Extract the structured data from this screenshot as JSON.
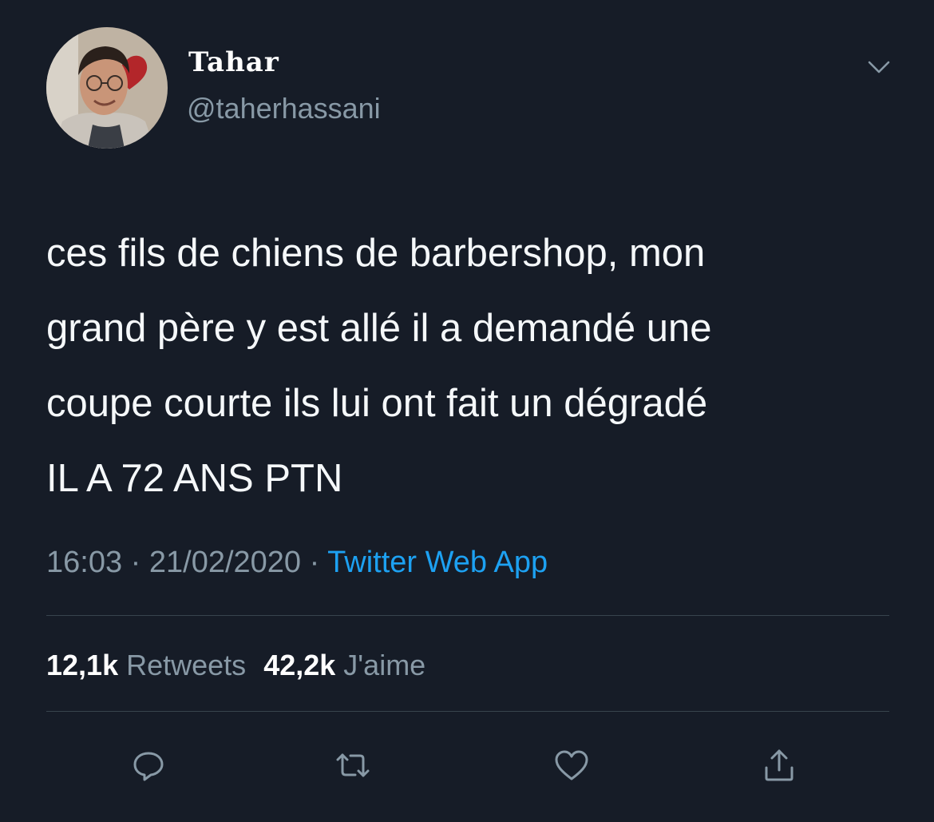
{
  "colors": {
    "background": "#161c27",
    "text_primary": "#f5f8fa",
    "text_secondary": "#8899a6",
    "link": "#1da1f2",
    "divider": "#38444d"
  },
  "author": {
    "display_name": "Tahar",
    "handle": "@taherhassani",
    "avatar": "avatar-photo"
  },
  "menu_icon": "chevron-down-icon",
  "tweet": {
    "text_lines": [
      "ces fils de chiens de barbershop, mon",
      "grand père y est allé il a demandé une",
      "coupe courte ils lui ont fait un dégradé",
      "IL A 72 ANS PTN"
    ],
    "time": "16:03",
    "date": "21/02/2020",
    "separator": "·",
    "source": "Twitter Web App"
  },
  "stats": {
    "retweets_count": "12,1k",
    "retweets_label": "Retweets",
    "likes_count": "42,2k",
    "likes_label": "J'aime"
  },
  "actions": [
    {
      "icon": "reply-icon"
    },
    {
      "icon": "retweet-icon"
    },
    {
      "icon": "like-heart-icon"
    },
    {
      "icon": "share-icon"
    }
  ]
}
